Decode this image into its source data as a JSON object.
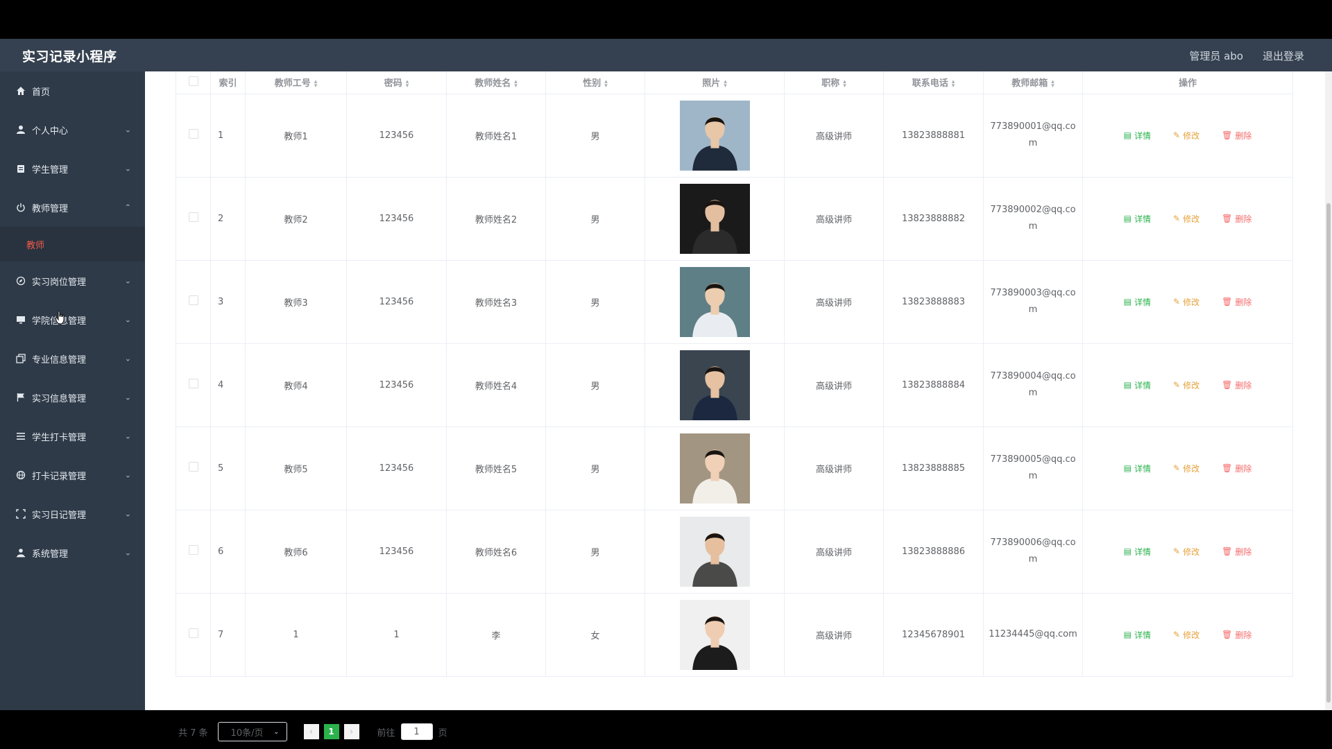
{
  "header": {
    "title": "实习记录小程序",
    "user": "管理员 abo",
    "logout": "退出登录"
  },
  "sidebar": {
    "items": [
      {
        "label": "首页",
        "icon": "home-icon",
        "chevron": ""
      },
      {
        "label": "个人中心",
        "icon": "user-icon",
        "chevron": "⌄"
      },
      {
        "label": "学生管理",
        "icon": "clipboard-icon",
        "chevron": "⌄"
      },
      {
        "label": "教师管理",
        "icon": "power-icon",
        "chevron": "⌃"
      },
      {
        "label": "实习岗位管理",
        "icon": "compass-icon",
        "chevron": "⌄"
      },
      {
        "label": "学院信息管理",
        "icon": "monitor-icon",
        "chevron": "⌄"
      },
      {
        "label": "专业信息管理",
        "icon": "copy-icon",
        "chevron": "⌄"
      },
      {
        "label": "实习信息管理",
        "icon": "flag-icon",
        "chevron": "⌄"
      },
      {
        "label": "学生打卡管理",
        "icon": "list-icon",
        "chevron": "⌄"
      },
      {
        "label": "打卡记录管理",
        "icon": "globe-icon",
        "chevron": "⌄"
      },
      {
        "label": "实习日记管理",
        "icon": "fullscreen-icon",
        "chevron": "⌄"
      },
      {
        "label": "系统管理",
        "icon": "person-icon",
        "chevron": "⌄"
      }
    ],
    "active_sub": "教师"
  },
  "table": {
    "columns": [
      "索引",
      "教师工号",
      "密码",
      "教师姓名",
      "性别",
      "照片",
      "职称",
      "联系电话",
      "教师邮箱",
      "操作"
    ],
    "rows": [
      {
        "index": "1",
        "id": "教师1",
        "password": "123456",
        "name": "教师姓名1",
        "gender": "男",
        "title": "高级讲师",
        "phone": "13823888881",
        "email": "773890001@qq.com"
      },
      {
        "index": "2",
        "id": "教师2",
        "password": "123456",
        "name": "教师姓名2",
        "gender": "男",
        "title": "高级讲师",
        "phone": "13823888882",
        "email": "773890002@qq.com"
      },
      {
        "index": "3",
        "id": "教师3",
        "password": "123456",
        "name": "教师姓名3",
        "gender": "男",
        "title": "高级讲师",
        "phone": "13823888883",
        "email": "773890003@qq.com"
      },
      {
        "index": "4",
        "id": "教师4",
        "password": "123456",
        "name": "教师姓名4",
        "gender": "男",
        "title": "高级讲师",
        "phone": "13823888884",
        "email": "773890004@qq.com"
      },
      {
        "index": "5",
        "id": "教师5",
        "password": "123456",
        "name": "教师姓名5",
        "gender": "男",
        "title": "高级讲师",
        "phone": "13823888885",
        "email": "773890005@qq.com"
      },
      {
        "index": "6",
        "id": "教师6",
        "password": "123456",
        "name": "教师姓名6",
        "gender": "男",
        "title": "高级讲师",
        "phone": "13823888886",
        "email": "773890006@qq.com"
      },
      {
        "index": "7",
        "id": "1",
        "password": "1",
        "name": "李",
        "gender": "女",
        "title": "高级讲师",
        "phone": "12345678901",
        "email": "11234445@qq.com"
      }
    ],
    "actions": {
      "detail": "详情",
      "edit": "修改",
      "delete": "删除"
    }
  },
  "pagination": {
    "total": "共 7 条",
    "page_size": "10条/页",
    "current_page": "1",
    "goto_label": "前往",
    "goto_value": "1",
    "page_suffix": "页"
  },
  "colors": {
    "header_bg": "#354150",
    "sidebar_bg": "#2e3a48",
    "active_sub": "#f2594b",
    "detail": "#2bb24c",
    "edit": "#e6a23c",
    "delete": "#f56c6c",
    "page_active": "#2bb24c"
  }
}
